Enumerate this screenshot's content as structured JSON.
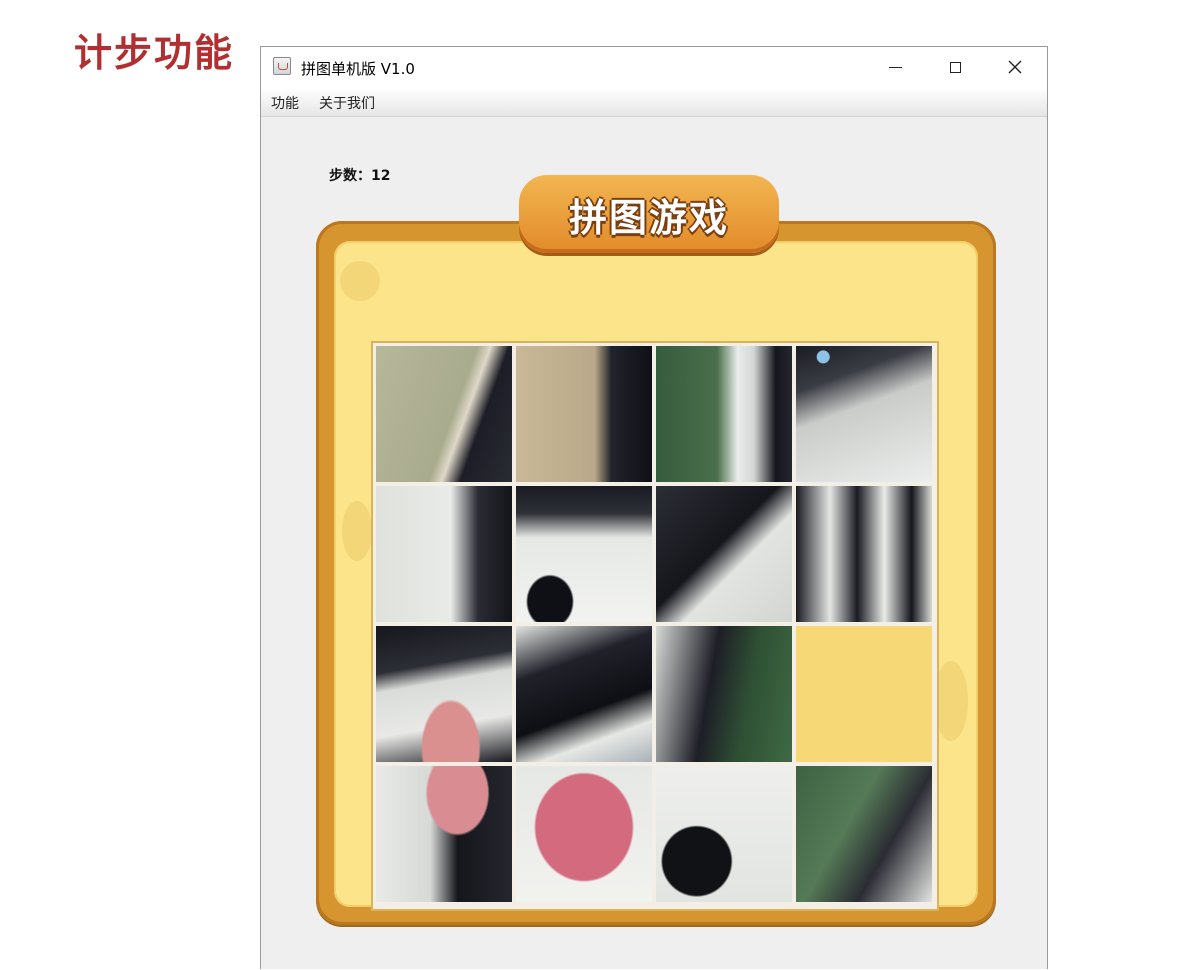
{
  "slide": {
    "title": "计步功能"
  },
  "window": {
    "title": "拼图单机版 V1.0",
    "minimize_icon": "minimize-icon",
    "maximize_icon": "maximize-icon",
    "close_icon": "close-icon"
  },
  "menu": {
    "items": [
      "功能",
      "关于我们"
    ]
  },
  "game": {
    "step_label": "步数：",
    "steps": "12",
    "banner_title": "拼图游戏",
    "board": {
      "rows": 4,
      "cols": 4,
      "empty_tile": {
        "row": 3,
        "col": 4
      }
    }
  },
  "colors": {
    "frame": "#d6952e",
    "board": "#fbe48a",
    "title_red": "#b03032"
  }
}
